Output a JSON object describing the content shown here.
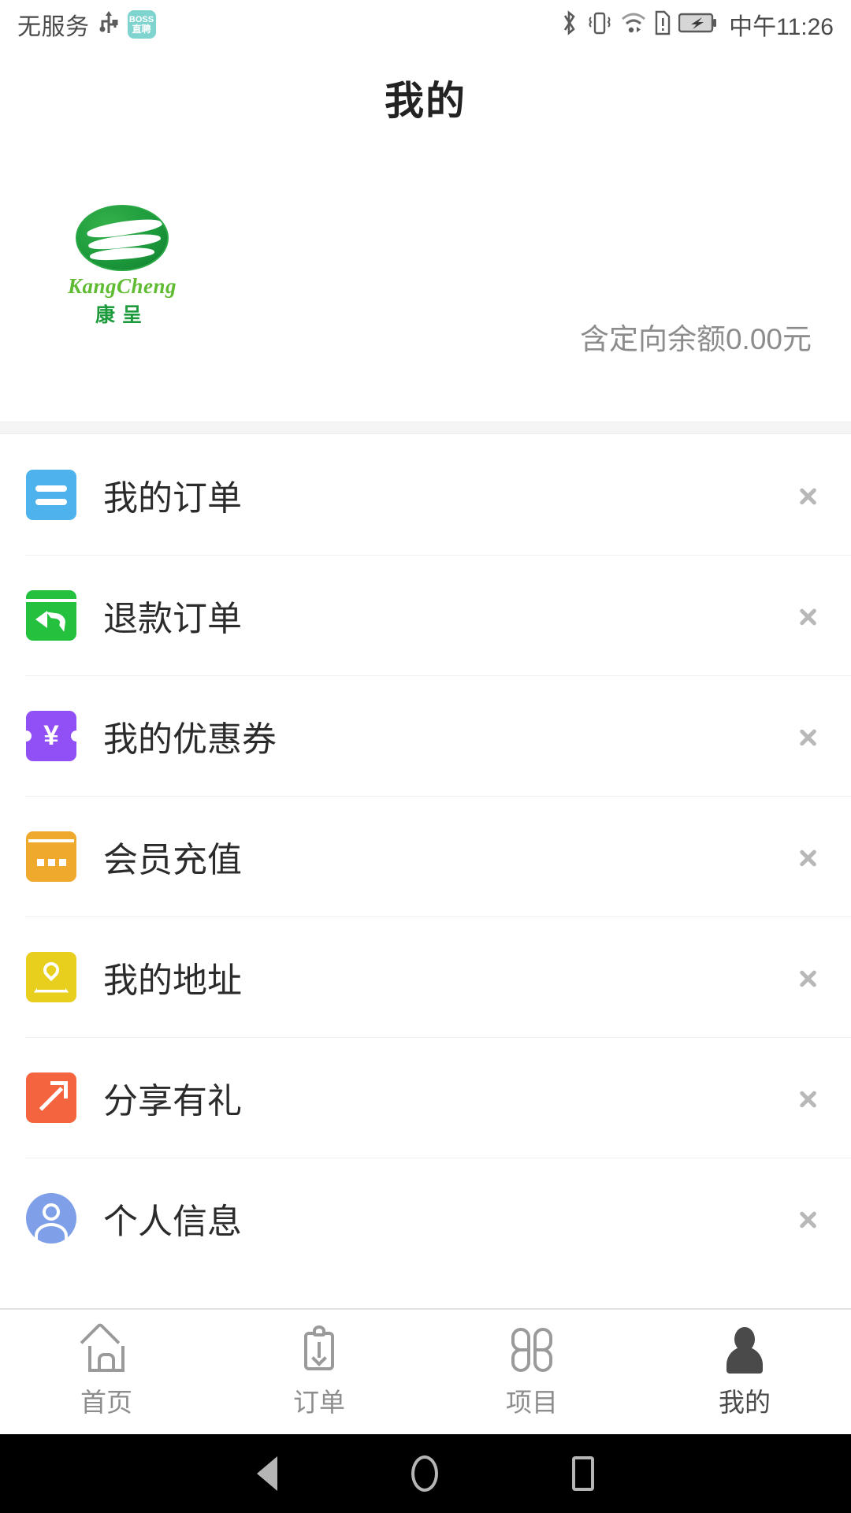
{
  "status_bar": {
    "carrier": "无服务",
    "usb_icon": "usb-icon",
    "app_badge_line1": "BOSS",
    "app_badge_line2": "直聘",
    "bluetooth_icon": "bluetooth-icon",
    "vibrate_icon": "vibrate-icon",
    "wifi_icon": "wifi-icon",
    "sim_alert_icon": "sim-alert-icon",
    "battery_icon": "battery-charging-icon",
    "clock": "中午11:26"
  },
  "header": {
    "title": "我的"
  },
  "profile": {
    "logo_en": "KangCheng",
    "logo_cn": "康呈",
    "balance_text": "含定向余额0.00元"
  },
  "menu": {
    "items": [
      {
        "label": "我的订单",
        "icon": "orders-icon",
        "color": "#4eb3ec"
      },
      {
        "label": "退款订单",
        "icon": "refund-icon",
        "color": "#24c13f"
      },
      {
        "label": "我的优惠券",
        "icon": "coupon-icon",
        "color": "#9150f5",
        "symbol": "¥"
      },
      {
        "label": "会员充值",
        "icon": "recharge-icon",
        "color": "#efa92d"
      },
      {
        "label": "我的地址",
        "icon": "address-icon",
        "color": "#e8cf1e"
      },
      {
        "label": "分享有礼",
        "icon": "share-icon",
        "color": "#f4653f"
      },
      {
        "label": "个人信息",
        "icon": "person-icon",
        "color": "#7f9fe8"
      }
    ]
  },
  "tabbar": {
    "tabs": [
      {
        "label": "首页",
        "icon": "home-icon",
        "active": false
      },
      {
        "label": "订单",
        "icon": "clipboard-icon",
        "active": false
      },
      {
        "label": "项目",
        "icon": "grid-icon",
        "active": false
      },
      {
        "label": "我的",
        "icon": "person-icon",
        "active": true
      }
    ]
  },
  "android_nav": {
    "back_icon": "back-triangle-icon",
    "home_icon": "home-circle-icon",
    "recents_icon": "recents-square-icon"
  }
}
